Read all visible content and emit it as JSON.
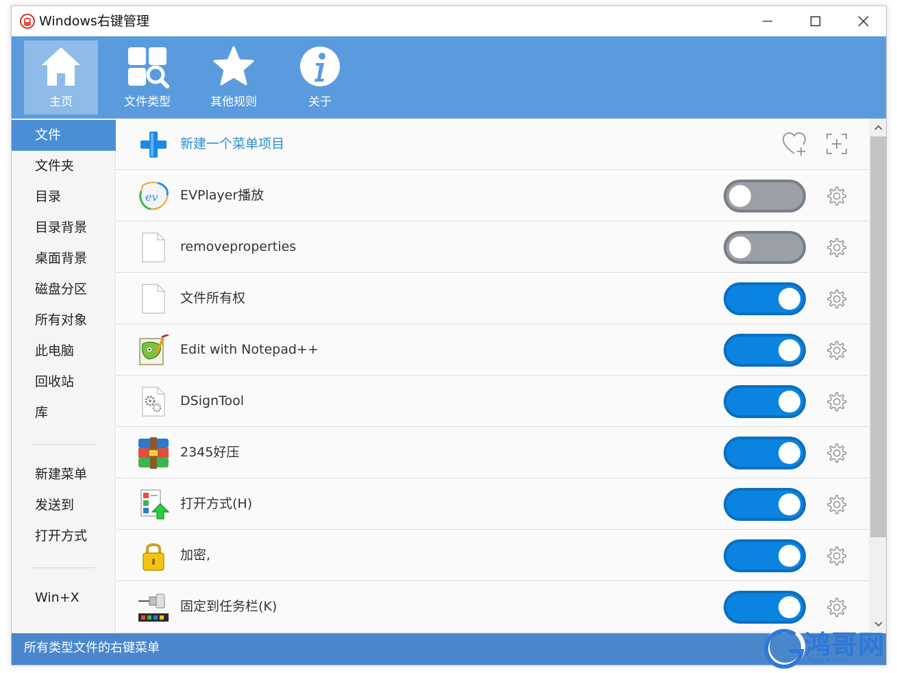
{
  "window": {
    "title": "Windows右键管理"
  },
  "topnav": {
    "items": [
      {
        "label": "主页",
        "icon": "home-icon",
        "active": true
      },
      {
        "label": "文件类型",
        "icon": "file-type-search-icon",
        "active": false
      },
      {
        "label": "其他规则",
        "icon": "star-icon",
        "active": false
      },
      {
        "label": "关于",
        "icon": "info-icon",
        "active": false
      }
    ]
  },
  "sidebar": {
    "items": [
      {
        "label": "文件",
        "active": true
      },
      {
        "label": "文件夹"
      },
      {
        "label": "目录"
      },
      {
        "label": "目录背景"
      },
      {
        "label": "桌面背景"
      },
      {
        "label": "磁盘分区"
      },
      {
        "label": "所有对象"
      },
      {
        "label": "此电脑"
      },
      {
        "label": "回收站"
      },
      {
        "label": "库"
      },
      {
        "label": "新建菜单"
      },
      {
        "label": "发送到"
      },
      {
        "label": "打开方式"
      },
      {
        "label": "Win+X"
      }
    ]
  },
  "main": {
    "new_item": {
      "label": "新建一个菜单项目",
      "icon": "add-plus-icon"
    },
    "items": [
      {
        "label": "EVPlayer播放",
        "icon": "evplayer-icon",
        "enabled": false
      },
      {
        "label": "removeproperties",
        "icon": "blank-file-icon",
        "enabled": false
      },
      {
        "label": "文件所有权",
        "icon": "blank-file-icon",
        "enabled": true
      },
      {
        "label": "Edit with Notepad++",
        "icon": "notepad-plus-plus-icon",
        "enabled": true
      },
      {
        "label": "DSignTool",
        "icon": "gear-file-icon",
        "enabled": true
      },
      {
        "label": "2345好压",
        "icon": "archive-icon",
        "enabled": true
      },
      {
        "label": "打开方式(H)",
        "icon": "open-with-icon",
        "enabled": true
      },
      {
        "label": "加密,",
        "icon": "lock-icon",
        "enabled": true
      },
      {
        "label": "固定到任务栏(K)",
        "icon": "pin-taskbar-icon",
        "enabled": true
      }
    ]
  },
  "statusbar": {
    "text": "所有类型文件的右键菜单"
  },
  "watermark": {
    "text": "鸿哥网",
    "sub": "hgzyw.com"
  },
  "colors": {
    "accent": "#5a9bde",
    "toggle_on": "#0a84e0",
    "toggle_off": "#9aa0a6",
    "status_bar": "#4a86cc"
  }
}
